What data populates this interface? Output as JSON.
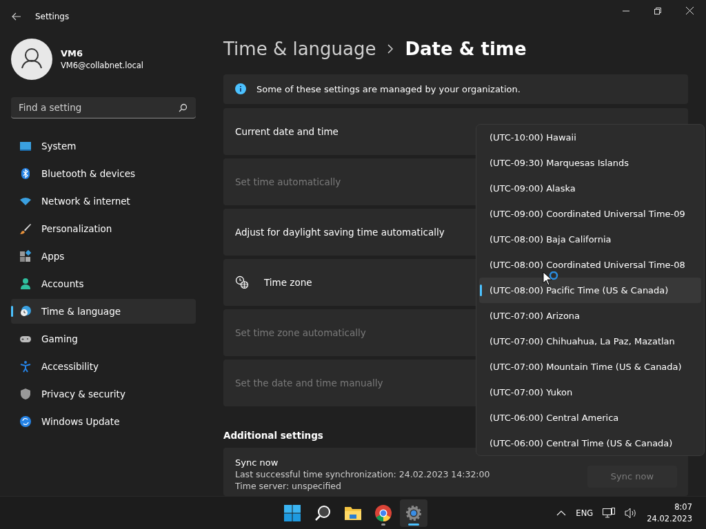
{
  "window": {
    "title": "Settings"
  },
  "user": {
    "name": "VM6",
    "email": "VM6@collabnet.local"
  },
  "search": {
    "placeholder": "Find a setting"
  },
  "sidebar": {
    "items": [
      {
        "label": "System",
        "selected": false
      },
      {
        "label": "Bluetooth & devices",
        "selected": false
      },
      {
        "label": "Network & internet",
        "selected": false
      },
      {
        "label": "Personalization",
        "selected": false
      },
      {
        "label": "Apps",
        "selected": false
      },
      {
        "label": "Accounts",
        "selected": false
      },
      {
        "label": "Time & language",
        "selected": true
      },
      {
        "label": "Gaming",
        "selected": false
      },
      {
        "label": "Accessibility",
        "selected": false
      },
      {
        "label": "Privacy & security",
        "selected": false
      },
      {
        "label": "Windows Update",
        "selected": false
      }
    ]
  },
  "breadcrumb": {
    "parent": "Time & language",
    "current": "Date & time"
  },
  "info_banner": {
    "text": "Some of these settings are managed by your organization."
  },
  "settings": [
    {
      "label": "Current date and time",
      "kind": "plain",
      "disabled": false
    },
    {
      "label": "Set time automatically",
      "kind": "plain",
      "disabled": true
    },
    {
      "label": "Adjust for daylight saving time automatically",
      "kind": "plain",
      "disabled": false
    },
    {
      "label": "Time zone",
      "kind": "icon",
      "disabled": false
    },
    {
      "label": "Set time zone automatically",
      "kind": "plain",
      "disabled": true
    },
    {
      "label": "Set the date and time manually",
      "kind": "plain",
      "disabled": true
    }
  ],
  "additional_settings": {
    "heading": "Additional settings",
    "sync": {
      "title": "Sync now",
      "detail": "Last successful time synchronization: 24.02.2023 14:32:00",
      "detail_2": "Time server: unspecified",
      "button": {
        "label": "Sync now",
        "disabled": true
      }
    }
  },
  "timezone_dropdown": {
    "options": [
      {
        "label": "(UTC-10:00) Hawaii",
        "selected": false
      },
      {
        "label": "(UTC-09:30) Marquesas Islands",
        "selected": false
      },
      {
        "label": "(UTC-09:00) Alaska",
        "selected": false
      },
      {
        "label": "(UTC-09:00) Coordinated Universal Time-09",
        "selected": false
      },
      {
        "label": "(UTC-08:00) Baja California",
        "selected": false
      },
      {
        "label": "(UTC-08:00) Coordinated Universal Time-08",
        "selected": false
      },
      {
        "label": "(UTC-08:00) Pacific Time (US & Canada)",
        "selected": true
      },
      {
        "label": "(UTC-07:00) Arizona",
        "selected": false
      },
      {
        "label": "(UTC-07:00) Chihuahua, La Paz, Mazatlan",
        "selected": false
      },
      {
        "label": "(UTC-07:00) Mountain Time (US & Canada)",
        "selected": false
      },
      {
        "label": "(UTC-07:00) Yukon",
        "selected": false
      },
      {
        "label": "(UTC-06:00) Central America",
        "selected": false
      },
      {
        "label": "(UTC-06:00) Central Time (US & Canada)",
        "selected": false
      }
    ]
  },
  "taskbar": {
    "apps": [
      {
        "kind": "start",
        "selected": false,
        "running": false
      },
      {
        "kind": "search",
        "selected": false,
        "running": false
      },
      {
        "kind": "files",
        "selected": false,
        "running": false
      },
      {
        "kind": "browser",
        "selected": false,
        "running": true
      },
      {
        "kind": "settings",
        "selected": true,
        "running": true
      }
    ],
    "language": "ENG",
    "time": "8:07",
    "date": "24.02.2023"
  }
}
